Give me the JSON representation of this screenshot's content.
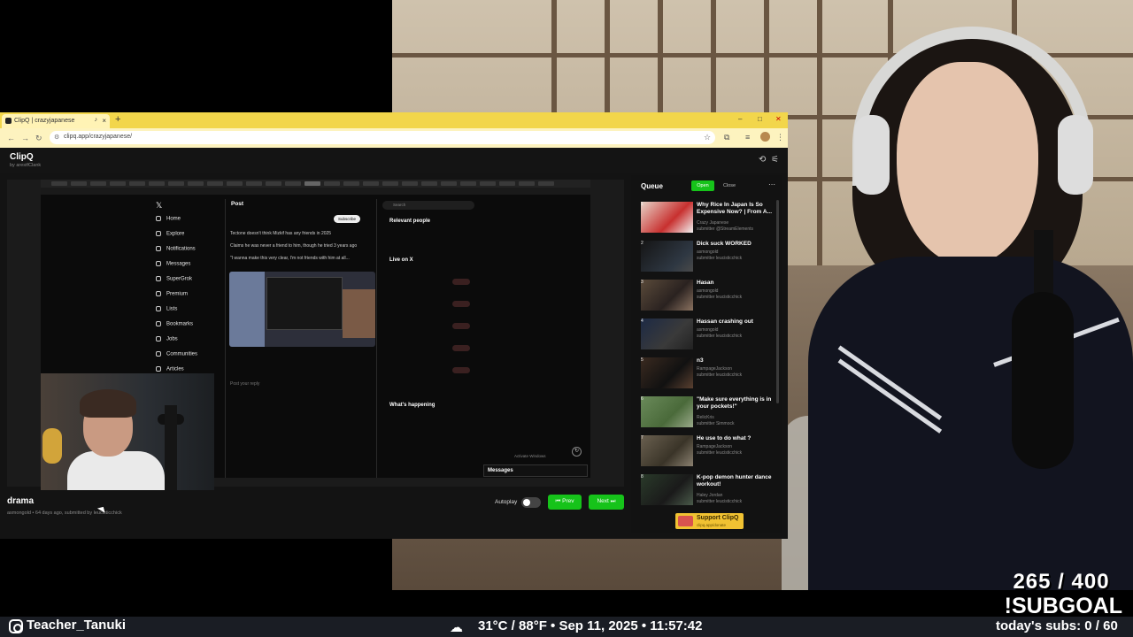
{
  "browser": {
    "tab_title": "ClipQ | crazyjapanese",
    "url": "clipq.app/crazyjapanese/"
  },
  "app": {
    "title": "ClipQ",
    "by": "by arestfClank"
  },
  "video": {
    "title": "drama",
    "meta": "asmongold • 64 days ago, submitted by leucisticchick",
    "autoplay_label": "Autoplay",
    "autoplay_on": false,
    "prev_label": "⏮ Prev",
    "next_label": "Next ⏭"
  },
  "queue": {
    "title": "Queue",
    "open_label": "Open",
    "close_label": "Close",
    "items": [
      {
        "num": "1",
        "title": "Why Rice In Japan Is So Expensive Now? | From A...",
        "channel": "Crazy Japanese",
        "submitter": "submitter @StreamElements"
      },
      {
        "num": "2",
        "title": "Dick suck WORKED",
        "channel": "asmongold",
        "submitter": "submitter leucisticchick"
      },
      {
        "num": "3",
        "title": "Hasan",
        "channel": "asmongold",
        "submitter": "submitter leucisticchick"
      },
      {
        "num": "4",
        "title": "Hassan crashing out",
        "channel": "asmongold",
        "submitter": "submitter leucisticchick"
      },
      {
        "num": "5",
        "title": "n3",
        "channel": "RampageJackson",
        "submitter": "submitter leucisticchick"
      },
      {
        "num": "6",
        "title": "\"Make sure everything is in your pockets!\"",
        "channel": "RelicKris",
        "submitter": "submitter Simmock"
      },
      {
        "num": "7",
        "title": "He use to do what ?",
        "channel": "RampageJackson",
        "submitter": "submitter leucisticchick"
      },
      {
        "num": "8",
        "title": "K-pop demon hunter dance workout!",
        "channel": "Haley Jordan",
        "submitter": "submitter leucisticchick"
      }
    ],
    "support_label": "Support ClipQ",
    "support_sub": "clipq.app/donate"
  },
  "embedded": {
    "post_header": "Post",
    "subscribe": "Subscribe",
    "nav": [
      "Home",
      "Explore",
      "Notifications",
      "Messages",
      "SuperGrok",
      "Premium",
      "Lists",
      "Bookmarks",
      "Jobs",
      "Communities",
      "Articles"
    ],
    "post_lines": [
      "Tectone doesn't think Mizkif has any friends in 2025",
      "Claims he was never a friend to him, though he tried 3 years ago",
      "\"I wanna make this very clear, I'm not friends with him at all..."
    ],
    "reply_placeholder": "Post your reply",
    "search": "Search",
    "relevant_people": "Relevant people",
    "live_on_x": "Live on X",
    "whats_happening": "What's happening",
    "messages": "Messages",
    "activate_windows": "Activate Windows"
  },
  "overlay": {
    "subgoal_count": "265 / 400",
    "subgoal_label": "!SUBGOAL",
    "handle": "Teacher_Tanuki",
    "weather": "31°C / 88°F • Sep 11, 2025 • 11:57:42",
    "subs_today": "today's subs: 0 / 60"
  },
  "colors": {
    "accent_green": "#16c31a",
    "tabbar_yellow": "#f2d64b",
    "support_yellow": "#f1c232"
  }
}
